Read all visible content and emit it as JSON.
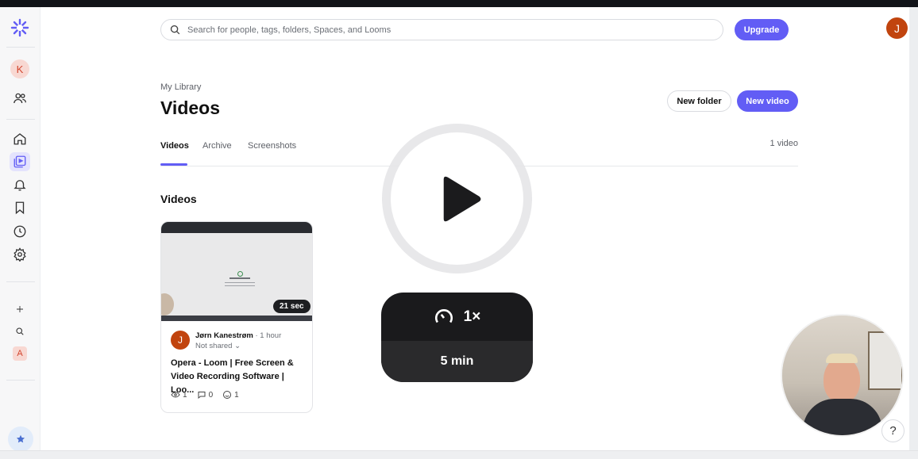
{
  "search": {
    "placeholder": "Search for people, tags, folders, Spaces, and Looms"
  },
  "header": {
    "upgrade_label": "Upgrade",
    "user_initial": "J"
  },
  "sidebar": {
    "workspace_initial": "K",
    "space_initial": "A",
    "items": [
      {
        "icon": "people-icon"
      },
      {
        "icon": "home-icon"
      },
      {
        "icon": "library-icon"
      },
      {
        "icon": "bell-icon"
      },
      {
        "icon": "bookmark-icon"
      },
      {
        "icon": "clock-icon"
      },
      {
        "icon": "gear-icon"
      },
      {
        "icon": "plus-icon"
      },
      {
        "icon": "search-icon"
      }
    ]
  },
  "page": {
    "breadcrumb": "My Library",
    "title": "Videos",
    "new_folder_label": "New folder",
    "new_video_label": "New video",
    "tabs": [
      {
        "label": "Videos",
        "active": true
      },
      {
        "label": "Archive",
        "active": false
      },
      {
        "label": "Screenshots",
        "active": false
      }
    ],
    "count": "1 video",
    "section_title": "Videos"
  },
  "video_card": {
    "duration": "21 sec",
    "author_initial": "J",
    "author": "Jørn Kanestrøm",
    "time": "· 1 hour",
    "sharing": "Not shared",
    "title": "Opera - Loom | Free Screen & Video Recording Software | Loo...",
    "views": "1",
    "comments": "0",
    "reactions": "1"
  },
  "overlay": {
    "speed": "1×",
    "duration": "5 min"
  },
  "help_label": "?",
  "colors": {
    "accent": "#625df5",
    "avatar": "#c1440e"
  }
}
